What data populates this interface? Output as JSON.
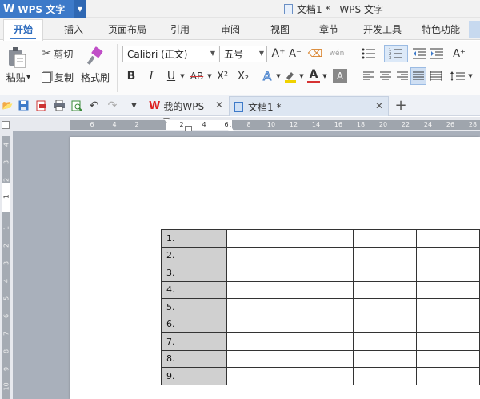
{
  "app": {
    "logo": "W",
    "name": "WPS 文字",
    "doc_title": "文档1 * - WPS 文字"
  },
  "menu": {
    "tabs": [
      "开始",
      "插入",
      "页面布局",
      "引用",
      "审阅",
      "视图",
      "章节",
      "开发工具",
      "特色功能"
    ]
  },
  "ribbon": {
    "paste": "粘贴",
    "cut": "剪切",
    "copy": "复制",
    "format_painter": "格式刷",
    "font_name": "Calibri (正文)",
    "font_size": "五号",
    "bold": "B",
    "italic": "I",
    "underline": "U",
    "strike": "AB",
    "superscript": "X²",
    "subscript": "X₂",
    "font_color_letter": "A",
    "grow_font": "A⁺",
    "shrink_font": "A⁻",
    "phonetic": "wén"
  },
  "doc_tabs": [
    {
      "label": "我的WPS"
    },
    {
      "label": "文档1 *"
    }
  ],
  "ruler": {
    "h_left": [
      "6",
      "4",
      "2"
    ],
    "h_white": [
      "2",
      "4",
      "6"
    ],
    "h_right": [
      "8",
      "10",
      "12",
      "14",
      "16",
      "18",
      "20",
      "22",
      "24",
      "26",
      "28"
    ],
    "v_top": [
      "4",
      "3",
      "2",
      "1"
    ],
    "v_bottom": [
      "1",
      "2",
      "3",
      "4",
      "5",
      "6",
      "7",
      "8",
      "9",
      "10"
    ]
  },
  "table": {
    "rows": [
      "1.",
      "2.",
      "3.",
      "4.",
      "5.",
      "6.",
      "7.",
      "8.",
      "9."
    ],
    "columns": 5
  },
  "colors": {
    "accent": "#3d7ac9",
    "font_color": "#d63333",
    "highlight": "#f0d200"
  }
}
